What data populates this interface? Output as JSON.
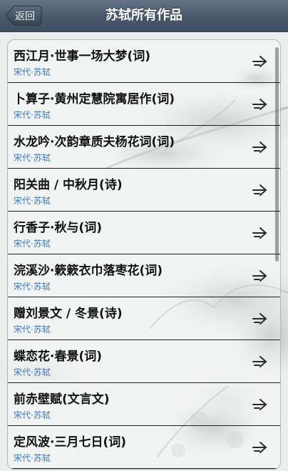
{
  "nav": {
    "back_label": "返回",
    "title": "苏轼所有作品"
  },
  "works": [
    {
      "title": "西江月·世事一场大梦(词)",
      "meta": "宋代·苏轼"
    },
    {
      "title": "卜算子·黄州定慧院寓居作(词)",
      "meta": "宋代·苏轼"
    },
    {
      "title": "水龙吟·次韵章质夫杨花词(词)",
      "meta": "宋代·苏轼"
    },
    {
      "title": "阳关曲 / 中秋月(诗)",
      "meta": "宋代·苏轼"
    },
    {
      "title": "行香子·秋与(词)",
      "meta": "宋代·苏轼"
    },
    {
      "title": "浣溪沙·簌簌衣巾落枣花(词)",
      "meta": "宋代·苏轼"
    },
    {
      "title": "赠刘景文 / 冬景(诗)",
      "meta": "宋代·苏轼"
    },
    {
      "title": "蝶恋花·春景(词)",
      "meta": "宋代·苏轼"
    },
    {
      "title": "前赤壁赋(文言文)",
      "meta": "宋代·苏轼"
    },
    {
      "title": "定风波·三月七日(词)",
      "meta": "宋代·苏轼"
    }
  ],
  "icons": {
    "back": "back-arrow-button",
    "row_arrow": "right-arrow-icon"
  },
  "colors": {
    "navbar": "#4a5a6c",
    "meta_text": "#3f77b8",
    "title_text": "#111111"
  }
}
